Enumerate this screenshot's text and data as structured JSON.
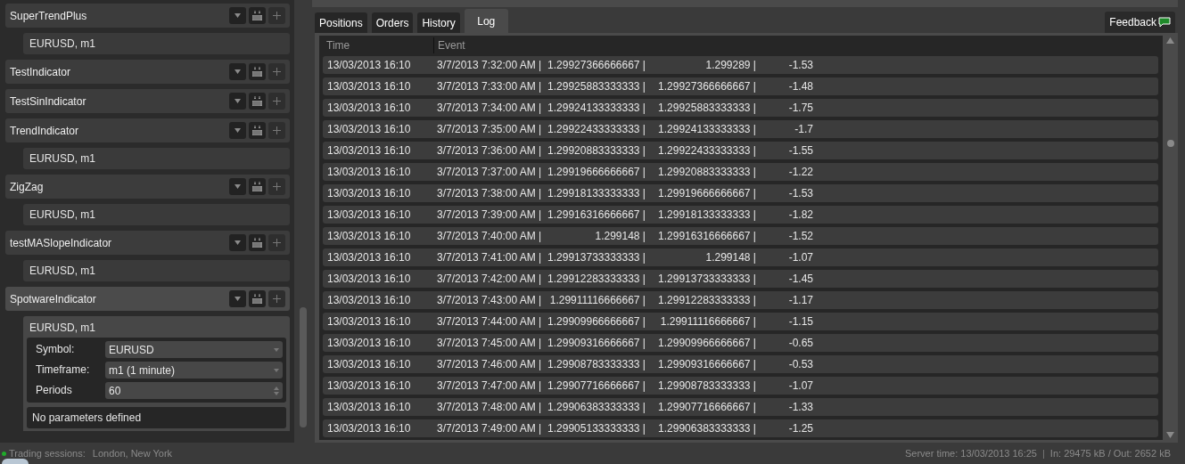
{
  "indicators": [
    {
      "name": "SuperTrendPlus",
      "selected": false,
      "instances": [
        {
          "label": "EURUSD, m1",
          "expanded": false
        }
      ]
    },
    {
      "name": "TestIndicator",
      "selected": false
    },
    {
      "name": "TestSinIndicator",
      "selected": false
    },
    {
      "name": "TrendIndicator",
      "selected": false,
      "instances": [
        {
          "label": "EURUSD, m1",
          "expanded": false
        }
      ]
    },
    {
      "name": "ZigZag",
      "selected": false,
      "instances": [
        {
          "label": "EURUSD, m1",
          "expanded": false
        }
      ]
    },
    {
      "name": "testMASlopeIndicator",
      "selected": false,
      "instances": [
        {
          "label": "EURUSD, m1",
          "expanded": false
        }
      ]
    },
    {
      "name": "SpotwareIndicator",
      "selected": true,
      "instances": [
        {
          "label": "EURUSD, m1",
          "expanded": true,
          "params": [
            {
              "label": "Symbol:",
              "value": "EURUSD",
              "kind": "dropdown"
            },
            {
              "label": "Timeframe:",
              "value": "m1 (1 minute)",
              "kind": "dropdown"
            },
            {
              "label": "Periods",
              "value": "60",
              "kind": "spinner"
            }
          ],
          "note": "No parameters defined"
        }
      ]
    }
  ],
  "tabs": [
    {
      "label": "Positions",
      "selected": false
    },
    {
      "label": "Orders",
      "selected": false
    },
    {
      "label": "History",
      "selected": false
    },
    {
      "label": "Log",
      "selected": true
    }
  ],
  "feedback": {
    "label": "Feedback"
  },
  "log": {
    "columns": [
      "Time",
      "Event"
    ],
    "rows": [
      {
        "time": "13/03/2013 16:10",
        "event": [
          "3/7/2013 7:32:00 AM |",
          "1.29927366666667 |",
          "1.299289 |",
          "-1.53"
        ]
      },
      {
        "time": "13/03/2013 16:10",
        "event": [
          "3/7/2013 7:33:00 AM |",
          "1.29925883333333 |",
          "1.29927366666667 |",
          "-1.48"
        ]
      },
      {
        "time": "13/03/2013 16:10",
        "event": [
          "3/7/2013 7:34:00 AM |",
          "1.29924133333333 |",
          "1.29925883333333 |",
          "-1.75"
        ]
      },
      {
        "time": "13/03/2013 16:10",
        "event": [
          "3/7/2013 7:35:00 AM |",
          "1.29922433333333 |",
          "1.29924133333333 |",
          "-1.7"
        ]
      },
      {
        "time": "13/03/2013 16:10",
        "event": [
          "3/7/2013 7:36:00 AM |",
          "1.29920883333333 |",
          "1.29922433333333 |",
          "-1.55"
        ]
      },
      {
        "time": "13/03/2013 16:10",
        "event": [
          "3/7/2013 7:37:00 AM |",
          "1.29919666666667 |",
          "1.29920883333333 |",
          "-1.22"
        ]
      },
      {
        "time": "13/03/2013 16:10",
        "event": [
          "3/7/2013 7:38:00 AM |",
          "1.29918133333333 |",
          "1.29919666666667 |",
          "-1.53"
        ]
      },
      {
        "time": "13/03/2013 16:10",
        "event": [
          "3/7/2013 7:39:00 AM |",
          "1.29916316666667 |",
          "1.29918133333333 |",
          "-1.82"
        ]
      },
      {
        "time": "13/03/2013 16:10",
        "event": [
          "3/7/2013 7:40:00 AM |",
          "1.299148 |",
          "1.29916316666667 |",
          "-1.52"
        ]
      },
      {
        "time": "13/03/2013 16:10",
        "event": [
          "3/7/2013 7:41:00 AM |",
          "1.29913733333333 |",
          "1.299148 |",
          "-1.07"
        ]
      },
      {
        "time": "13/03/2013 16:10",
        "event": [
          "3/7/2013 7:42:00 AM |",
          "1.29912283333333 |",
          "1.29913733333333 |",
          "-1.45"
        ]
      },
      {
        "time": "13/03/2013 16:10",
        "event": [
          "3/7/2013 7:43:00 AM |",
          "1.29911116666667 |",
          "1.29912283333333 |",
          "-1.17"
        ]
      },
      {
        "time": "13/03/2013 16:10",
        "event": [
          "3/7/2013 7:44:00 AM |",
          "1.29909966666667 |",
          "1.29911116666667 |",
          "-1.15"
        ]
      },
      {
        "time": "13/03/2013 16:10",
        "event": [
          "3/7/2013 7:45:00 AM |",
          "1.29909316666667 |",
          "1.29909966666667 |",
          "-0.65"
        ]
      },
      {
        "time": "13/03/2013 16:10",
        "event": [
          "3/7/2013 7:46:00 AM |",
          "1.29908783333333 |",
          "1.29909316666667 |",
          "-0.53"
        ]
      },
      {
        "time": "13/03/2013 16:10",
        "event": [
          "3/7/2013 7:47:00 AM |",
          "1.29907716666667 |",
          "1.29908783333333 |",
          "-1.07"
        ]
      },
      {
        "time": "13/03/2013 16:10",
        "event": [
          "3/7/2013 7:48:00 AM |",
          "1.29906383333333 |",
          "1.29907716666667 |",
          "-1.33"
        ]
      },
      {
        "time": "13/03/2013 16:10",
        "event": [
          "3/7/2013 7:49:00 AM |",
          "1.29905133333333 |",
          "1.29906383333333 |",
          "-1.25"
        ]
      }
    ]
  },
  "status_bar": {
    "connected": true,
    "sessions_label": "Trading sessions:",
    "sessions": "London, New York",
    "server_time": "Server time: 13/03/2013 16:25",
    "separator": "|",
    "traffic": "In: 29475 kB / Out: 2652 kB"
  }
}
